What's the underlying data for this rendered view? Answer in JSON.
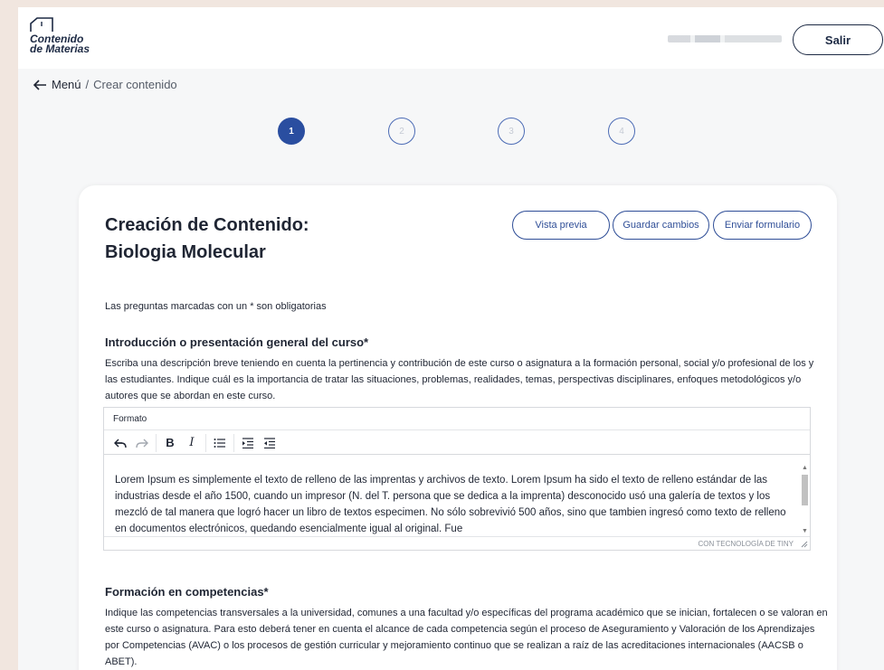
{
  "header": {
    "logo_line1": "Contenido",
    "logo_line2": "de Materias",
    "logout_label": "Salir"
  },
  "breadcrumb": {
    "back_label": "Menú",
    "separator": "/",
    "current": "Crear contenido"
  },
  "steps": [
    {
      "label": "1",
      "active": true
    },
    {
      "label": "2",
      "active": false
    },
    {
      "label": "3",
      "active": false
    },
    {
      "label": "4",
      "active": false
    }
  ],
  "card": {
    "title_line1": "Creación de Contenido:",
    "title_line2": "Biologia Molecular",
    "actions": {
      "preview": "Vista previa",
      "save": "Guardar cambios",
      "submit": "Enviar formulario"
    },
    "required_note": "Las preguntas marcadas con un * son obligatorias",
    "section1": {
      "title": "Introducción o presentación general del curso*",
      "description": "Escriba una descripción breve teniendo en cuenta la pertinencia y contribución de este curso o asignatura a la formación personal, social y/o profesional de los y las estudiantes. Indique cuál es la importancia de tratar las situaciones, problemas, realidades, temas, perspectivas disciplinares, enfoques metodológicos y/o autores que se abordan en este curso."
    },
    "editor": {
      "menu_label": "Formato",
      "content": "Lorem Ipsum es simplemente el texto de relleno de las imprentas y archivos de texto. Lorem Ipsum ha sido el texto de relleno estándar de las industrias desde el año 1500, cuando un impresor (N. del T. persona que se dedica a la imprenta) desconocido usó una galería de textos y los mezcló de tal manera que logró hacer un libro de textos especimen. No sólo sobrevivió 500 años, sino que tambien ingresó como texto de relleno en documentos electrónicos, quedando esencialmente igual al original. Fue",
      "status": "CON TECNOLOGÍA DE TINY"
    },
    "section2": {
      "title": "Formación en competencias*",
      "description": "Indique las competencias transversales a la universidad, comunes a una facultad y/o específicas del programa académico que se inician, fortalecen o se valoran en este curso o asignatura. Para esto deberá tener en cuenta el alcance de cada competencia según el proceso de Aseguramiento y Valoración de los Aprendizajes por Competencias (AVAC) o los procesos de gestión curricular y mejoramiento continuo que se realizan a raíz de las acreditaciones internacionales (AACSB o ABET)."
    }
  },
  "colors": {
    "primary": "#2a4ea0",
    "page_bg": "#f6f7f8",
    "outer_bg": "#f1e6df"
  }
}
